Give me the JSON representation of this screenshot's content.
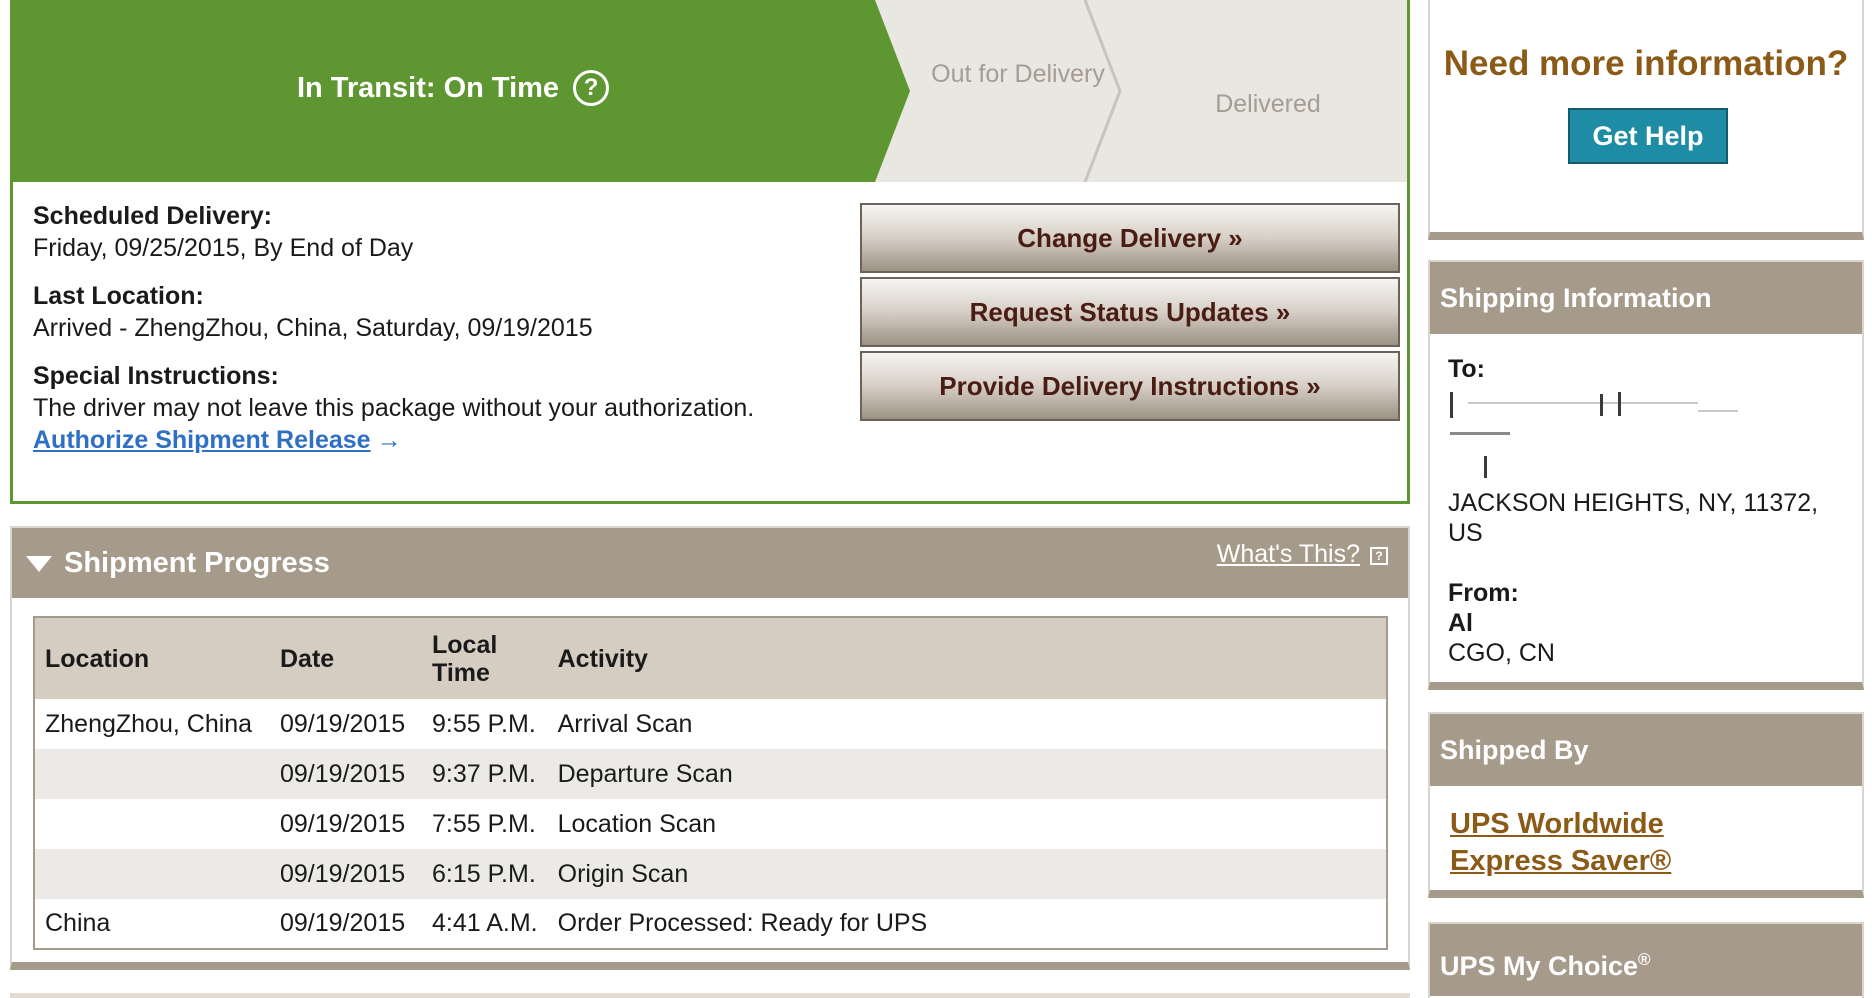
{
  "progress": {
    "current_stage": "In Transit: On Time",
    "help_icon": "?",
    "stage_out": "Out for Delivery",
    "stage_delivered": "Delivered",
    "colors": {
      "active": "#5e9732",
      "inactive": "#e9e7e2"
    }
  },
  "details": {
    "scheduled_label": "Scheduled Delivery:",
    "scheduled_value": "Friday, 09/25/2015, By End of Day",
    "last_location_label": "Last Location:",
    "last_location_value": "Arrived - ZhengZhou, China, Saturday, 09/19/2015",
    "special_label": "Special Instructions:",
    "special_value": "The driver may not leave this package without your authorization.",
    "authorize_link": "Authorize Shipment Release",
    "authorize_arrow": "→"
  },
  "actions": {
    "change": "Change Delivery »",
    "request": "Request Status Updates »",
    "provide": "Provide Delivery Instructions »"
  },
  "shipment_progress": {
    "title": "Shipment Progress",
    "whats_this": "What's This?",
    "whats_icon": "?",
    "columns": [
      "Location",
      "Date",
      "Local Time",
      "Activity"
    ],
    "rows": [
      {
        "location": "ZhengZhou, China",
        "date": "09/19/2015",
        "time": "9:55 P.M.",
        "activity": "Arrival Scan"
      },
      {
        "location": "",
        "date": "09/19/2015",
        "time": "9:37 P.M.",
        "activity": "Departure Scan"
      },
      {
        "location": "",
        "date": "09/19/2015",
        "time": "7:55 P.M.",
        "activity": "Location Scan"
      },
      {
        "location": "",
        "date": "09/19/2015",
        "time": "6:15 P.M.",
        "activity": "Origin Scan"
      },
      {
        "location": "China",
        "date": "09/19/2015",
        "time": "4:41 A.M.",
        "activity": "Order Processed: Ready for UPS"
      }
    ]
  },
  "sidebar": {
    "need_more": "Need more information?",
    "get_help": "Get Help",
    "shipping_info_title": "Shipping Information",
    "to_label": "To:",
    "to_address": "JACKSON HEIGHTS, NY, 11372, US",
    "from_label": "From:",
    "from_name": "Al",
    "from_location": "CGO, CN",
    "shipped_by_title": "Shipped By",
    "service": "UPS Worldwide Express Saver®",
    "my_choice_title": "UPS My Choice",
    "my_choice_mark": "®"
  }
}
